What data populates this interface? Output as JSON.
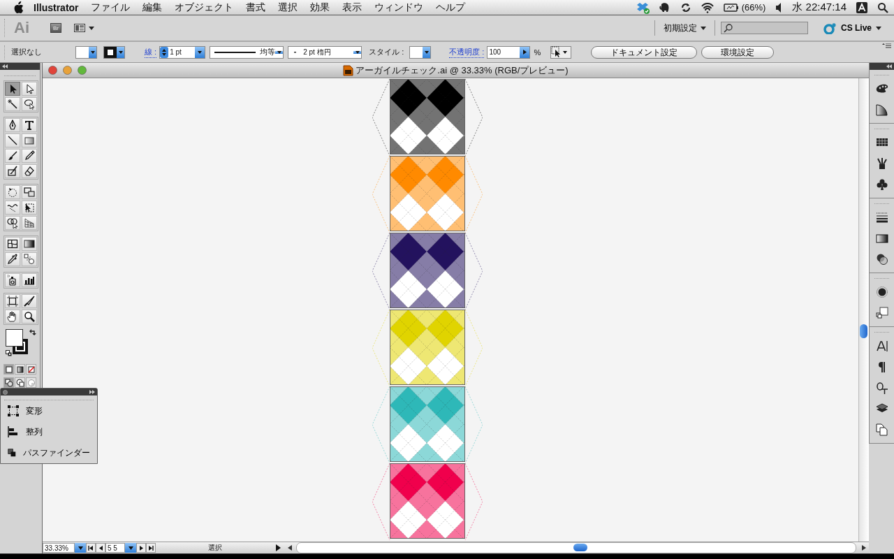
{
  "menu_bar": {
    "app_name": "Illustrator",
    "menus": [
      "ファイル",
      "編集",
      "オブジェクト",
      "書式",
      "選択",
      "効果",
      "表示",
      "ウィンドウ",
      "ヘルプ"
    ],
    "battery": "(66%)",
    "clock": "水 22:47:14"
  },
  "app_bar": {
    "logo": "Ai",
    "bridge": "Br",
    "workspace": "初期設定",
    "cs_live": "CS Live"
  },
  "control_bar": {
    "selection": "選択なし",
    "stroke_label": "線 :",
    "stroke_weight": "1 pt",
    "profile": "均等",
    "brush": "2 pt 楕円",
    "style_label": "スタイル :",
    "opacity_label": "不透明度 :",
    "opacity": "100",
    "percent": "%",
    "buttons": [
      "ドキュメント設定",
      "環境設定"
    ]
  },
  "toolbox": {
    "groups": [
      [
        {
          "kind": "selection",
          "selected": true
        },
        {
          "kind": "direct-selection",
          "selected": false
        },
        {
          "kind": "magic-wand",
          "selected": false
        },
        {
          "kind": "lasso",
          "selected": false
        }
      ],
      [
        {
          "kind": "pen",
          "selected": false
        },
        {
          "kind": "type",
          "selected": false
        },
        {
          "kind": "line",
          "selected": false
        },
        {
          "kind": "rectangle",
          "selected": false
        },
        {
          "kind": "paintbrush",
          "selected": false
        },
        {
          "kind": "pencil",
          "selected": false
        },
        {
          "kind": "blob-brush",
          "selected": false
        },
        {
          "kind": "eraser",
          "selected": false
        }
      ],
      [
        {
          "kind": "rotate",
          "selected": false
        },
        {
          "kind": "scale",
          "selected": false
        },
        {
          "kind": "warp",
          "selected": false
        },
        {
          "kind": "free-transform",
          "selected": false
        },
        {
          "kind": "shape-builder",
          "selected": false
        },
        {
          "kind": "perspective-grid",
          "selected": false
        }
      ],
      [
        {
          "kind": "mesh",
          "selected": false
        },
        {
          "kind": "gradient",
          "selected": false
        },
        {
          "kind": "eyedropper",
          "selected": false
        },
        {
          "kind": "blend",
          "selected": false
        }
      ],
      [
        {
          "kind": "symbol-sprayer",
          "selected": false
        },
        {
          "kind": "graph",
          "selected": false
        }
      ],
      [
        {
          "kind": "artboard",
          "selected": false
        },
        {
          "kind": "slice",
          "selected": false
        },
        {
          "kind": "hand",
          "selected": false
        },
        {
          "kind": "zoom",
          "selected": false
        }
      ]
    ],
    "color_modes": [
      {
        "kind": "color",
        "selected": true
      },
      {
        "kind": "gradient",
        "selected": false
      },
      {
        "kind": "none",
        "selected": false
      }
    ],
    "draw_modes": [
      {
        "kind": "normal",
        "selected": true
      },
      {
        "kind": "behind",
        "selected": false
      },
      {
        "kind": "inside",
        "selected": false
      }
    ]
  },
  "floating_panel": {
    "items": [
      {
        "kind": "transform",
        "label": "変形"
      },
      {
        "kind": "align",
        "label": "整列"
      },
      {
        "kind": "pathfinder",
        "label": "パスファインダー"
      }
    ]
  },
  "document": {
    "title": "アーガイルチェック.ai @ 33.33% (RGB/プレビュー)",
    "swatches": [
      {
        "color": "#000000"
      },
      {
        "color": "#ff8a00"
      },
      {
        "color": "#23125e"
      },
      {
        "color": "#e0d400"
      },
      {
        "color": "#2eb8b8"
      },
      {
        "color": "#f0004c"
      }
    ]
  },
  "right_dock": {
    "groups": [
      [
        {
          "kind": "color"
        },
        {
          "kind": "color-guide"
        }
      ],
      [
        {
          "kind": "swatches"
        },
        {
          "kind": "brushes"
        },
        {
          "kind": "symbols"
        }
      ],
      [
        {
          "kind": "stroke"
        },
        {
          "kind": "gradient"
        },
        {
          "kind": "transparency"
        }
      ],
      [
        {
          "kind": "appearance"
        },
        {
          "kind": "graphic-styles"
        }
      ],
      [
        {
          "kind": "character"
        },
        {
          "kind": "paragraph"
        },
        {
          "kind": "opentype"
        },
        {
          "kind": "layers"
        },
        {
          "kind": "artboards"
        }
      ]
    ]
  },
  "status_bar": {
    "zoom": "33.33%",
    "artboard": "5 5",
    "mode": "選択"
  }
}
